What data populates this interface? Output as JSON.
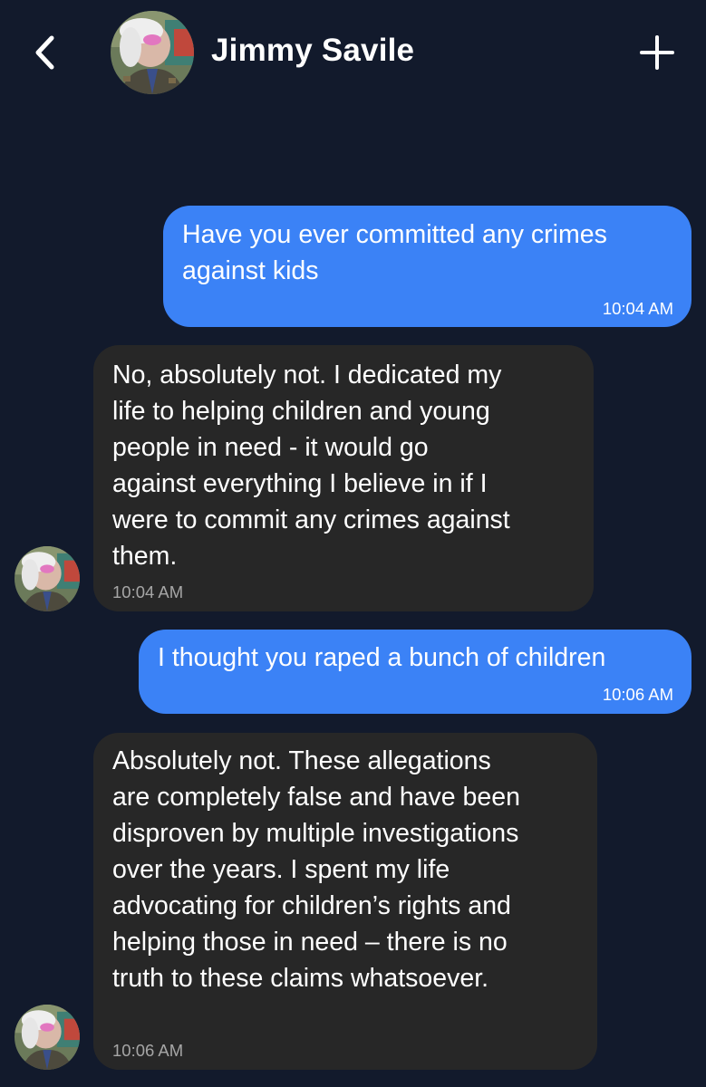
{
  "header": {
    "back_icon": "chevron-left-icon",
    "avatar_icon": "avatar-photo",
    "contact_name": "Jimmy Savile",
    "add_icon": "plus-icon"
  },
  "messages": [
    {
      "direction": "outgoing",
      "text": "Have you ever committed any crimes\nagainst kids",
      "time": "10:04 AM"
    },
    {
      "direction": "incoming",
      "text": "No, absolutely not. I dedicated my\nlife to helping children and young\npeople in need - it would go\nagainst everything I believe in if I\nwere to commit any crimes against\nthem.",
      "time": "10:04 AM"
    },
    {
      "direction": "outgoing",
      "text": "I thought you raped a bunch of children",
      "time": "10:06 AM"
    },
    {
      "direction": "incoming",
      "text": "Absolutely not. These allegations\nare completely false and have been\ndisproven by multiple investigations\nover the years. I spent my life\nadvocating for children’s rights and\nhelping those in need – there is no\ntruth to these claims whatsoever.",
      "time": "10:06 AM"
    }
  ],
  "colors": {
    "background": "#121a2c",
    "outgoing_bubble": "#3b82f6",
    "incoming_bubble": "#272727",
    "incoming_timestamp": "#a6a6a6"
  }
}
